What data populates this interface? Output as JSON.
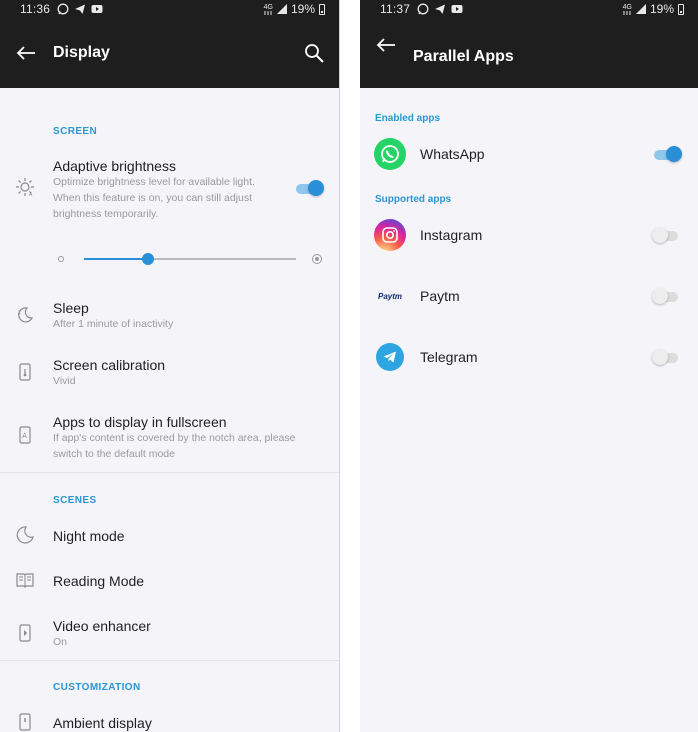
{
  "left": {
    "status": {
      "time": "11:36",
      "battery": "19%",
      "network": "4G"
    },
    "appbar": {
      "title": "Display"
    },
    "screen_header": "SCREEN",
    "adaptive_brightness": {
      "title": "Adaptive brightness",
      "subtitle": "Optimize brightness level for available light. When this feature is on, you can still adjust brightness temporarily.",
      "enabled": true
    },
    "brightness_level": 0.3,
    "sleep": {
      "title": "Sleep",
      "subtitle": "After 1 minute of inactivity"
    },
    "screen_calibration": {
      "title": "Screen calibration",
      "subtitle": "Vivid"
    },
    "fullscreen_apps": {
      "title": "Apps to display in fullscreen",
      "subtitle": "If app's content is covered by the notch area, please switch to the default mode"
    },
    "scenes_header": "SCENES",
    "night_mode": {
      "title": "Night mode"
    },
    "reading_mode": {
      "title": "Reading Mode"
    },
    "video_enhancer": {
      "title": "Video enhancer",
      "subtitle": "On"
    },
    "customization_header": "CUSTOMIZATION",
    "ambient_display": {
      "title": "Ambient display"
    }
  },
  "right": {
    "status": {
      "time": "11:37",
      "battery": "19%",
      "network": "4G"
    },
    "appbar": {
      "title": "Parallel Apps"
    },
    "enabled_header": "Enabled apps",
    "supported_header": "Supported apps",
    "apps": {
      "whatsapp": {
        "name": "WhatsApp",
        "enabled": true,
        "color": "#25d366"
      },
      "instagram": {
        "name": "Instagram",
        "enabled": false,
        "color": "#c13584"
      },
      "paytm": {
        "name": "Paytm",
        "enabled": false,
        "logo_text": "Paytm",
        "color": "#00baf2"
      },
      "telegram": {
        "name": "Telegram",
        "enabled": false,
        "color": "#2ca5e0"
      }
    }
  },
  "colors": {
    "accent": "#2a96d3",
    "toggle_on": "#2a8fd9",
    "bar": "#1e1e1e",
    "background": "#f5f5f9"
  }
}
